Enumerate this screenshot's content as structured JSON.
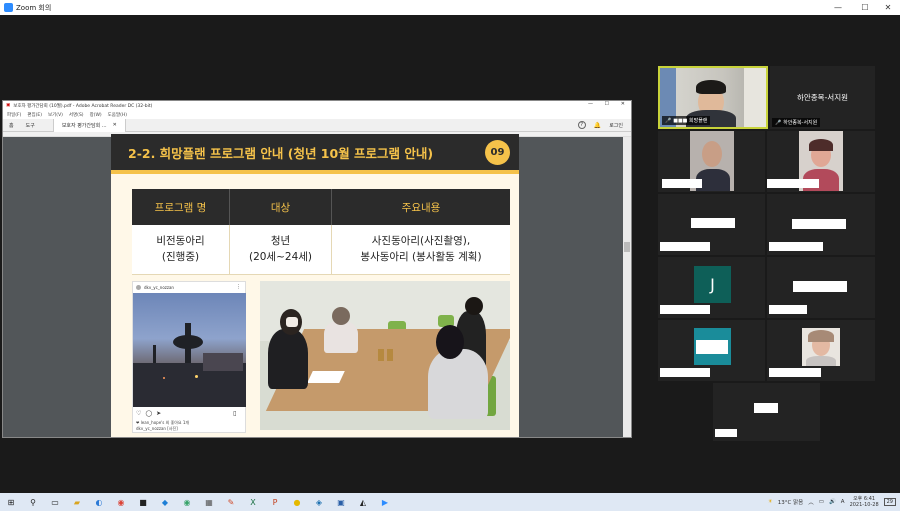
{
  "zoom": {
    "title": "Zoom 회의",
    "controls": {
      "minimize": "—",
      "maximize": "☐",
      "close": "✕"
    }
  },
  "acrobat": {
    "title": "보호자 평가간담회 (10월).pdf - Adobe Acrobat Reader DC (32-bit)",
    "menu": [
      "파일(F)",
      "편집(E)",
      "보기(V)",
      "서명(S)",
      "창(W)",
      "도움말(H)"
    ],
    "tabs": {
      "home": "홈",
      "tools": "도구",
      "document": "보호자 평가간담회 ...",
      "close": "✕"
    },
    "signin": "로그인",
    "help": "?",
    "bell": "🔔"
  },
  "slide": {
    "title": "2-2. 희망플랜 프로그램 안내 (청년 10월 프로그램 안내)",
    "page_number": "09",
    "table": {
      "headers": [
        "프로그램 명",
        "대상",
        "주요내용"
      ],
      "rows": [
        {
          "name_line1": "비전동아리",
          "name_line2": "(진행중)",
          "target_line1": "청년",
          "target_line2": "(20세~24세)",
          "content_line1": "사진동아리(사진촬영),",
          "content_line2": "봉사동아리 (봉사활동 계획)"
        }
      ]
    },
    "instagram": {
      "username": "dkv_yc_nozzan",
      "caption_line1": "❤ lean_hope's 외 좋아요 1개",
      "caption_line2": "dkv_yc_nozzan [사진]",
      "more": "⋮"
    }
  },
  "participants": [
    {
      "name": "■■■ 희망플랜",
      "role": "active-speaker"
    },
    {
      "name": "하안종복-서지원",
      "tag": "하안종복-서지원"
    },
    {
      "initial": "J"
    }
  ],
  "taskbar": {
    "weather": "13°C 맑음",
    "time": "오후 6:41",
    "date": "2021-10-28",
    "notification": "29",
    "lang": "A"
  }
}
